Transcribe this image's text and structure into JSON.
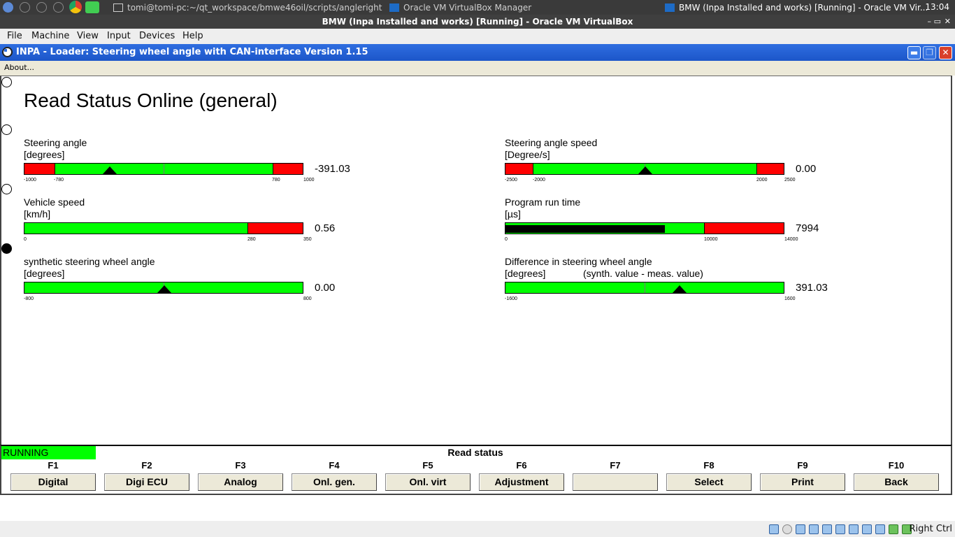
{
  "taskbar": {
    "tasks": [
      {
        "label": "tomi@tomi-pc:~/qt_workspace/bmwe46oil/scripts/angleright"
      },
      {
        "label": "Oracle VM VirtualBox Manager"
      },
      {
        "label": "BMW (Inpa Installed and works) [Running] - Oracle VM Vir..."
      }
    ],
    "clock": "13:04"
  },
  "vbox": {
    "title": "BMW (Inpa Installed and works) [Running] - Oracle VM VirtualBox",
    "menu": [
      "File",
      "Machine",
      "View",
      "Input",
      "Devices",
      "Help"
    ],
    "host_key": "Right Ctrl"
  },
  "inpa": {
    "title": "INPA - Loader:  Steering wheel angle with CAN-interface Version 1.15",
    "about": "About..."
  },
  "page_title": "Read Status Online (general)",
  "gauges": {
    "steering_angle": {
      "label": "Steering angle",
      "unit": "[degrees]",
      "value": "-391.03",
      "min": -1000,
      "max": 1000,
      "marker": -391.03,
      "ticks": [
        "-1000",
        "-780",
        "780",
        "1000"
      ]
    },
    "steering_angle_speed": {
      "label": "Steering angle speed",
      "unit": "[Degree/s]",
      "value": "0.00",
      "min": -2500,
      "max": 2500,
      "marker": 0,
      "ticks": [
        "-2500",
        "-2000",
        "2000",
        "2500"
      ]
    },
    "vehicle_speed": {
      "label": "Vehicle speed",
      "unit": "[km/h]",
      "value": "0.56",
      "min": 0,
      "max": 350,
      "ticks": [
        "0",
        "280",
        "350"
      ]
    },
    "program_run_time": {
      "label": "Program run time",
      "unit": "[µs]",
      "value": "7994",
      "min": 0,
      "max": 14000,
      "fill": 7994,
      "ticks": [
        "0",
        "10000",
        "14000"
      ]
    },
    "synthetic_angle": {
      "label": "synthetic steering wheel angle",
      "unit": "[degrees]",
      "value": "0.00",
      "min": -800,
      "max": 800,
      "marker": 0,
      "ticks": [
        "-800",
        "800"
      ]
    },
    "angle_difference": {
      "label": "Difference in steering wheel angle",
      "unit": "[degrees]",
      "note": "(synth. value - meas. value)",
      "value": "391.03",
      "min": -1600,
      "max": 1600,
      "marker": 391.03,
      "ticks": [
        "-1600",
        "1600"
      ]
    }
  },
  "status": {
    "state": "RUNNING",
    "title": "Read status",
    "state_color": "#00ff00"
  },
  "function_keys": [
    {
      "key": "F1",
      "label": "Digital"
    },
    {
      "key": "F2",
      "label": "Digi ECU"
    },
    {
      "key": "F3",
      "label": "Analog"
    },
    {
      "key": "F4",
      "label": "Onl. gen."
    },
    {
      "key": "F5",
      "label": "Onl. virt"
    },
    {
      "key": "F6",
      "label": "Adjustment"
    },
    {
      "key": "F7",
      "label": ""
    },
    {
      "key": "F8",
      "label": "Select"
    },
    {
      "key": "F9",
      "label": "Print"
    },
    {
      "key": "F10",
      "label": "Back"
    }
  ],
  "colors": {
    "ok": "#00ff00",
    "limit": "#ff0000",
    "title_bar": "#1c56c9"
  }
}
